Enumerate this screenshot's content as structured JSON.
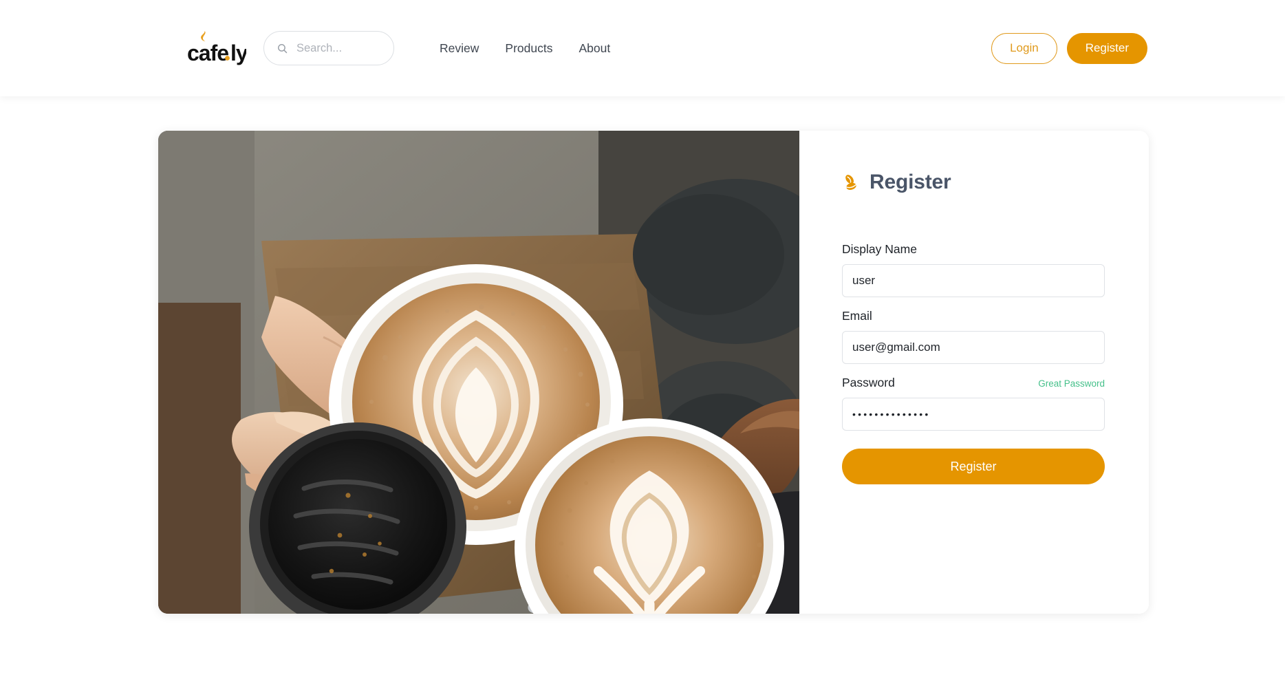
{
  "header": {
    "logo": {
      "name": "cafe.ly",
      "icon": "cafely-steam-logo"
    },
    "search": {
      "icon": "search-icon",
      "placeholder": "Search...",
      "value": ""
    },
    "nav": [
      {
        "label": "Review"
      },
      {
        "label": "Products"
      },
      {
        "label": "About"
      }
    ],
    "auth": {
      "login_label": "Login",
      "register_label": "Register"
    }
  },
  "card": {
    "photo": {
      "alt": "Three hands toasting coffee cups with latte art on a wooden table"
    },
    "form": {
      "icon": "coffee-bean-icon",
      "title": "Register",
      "fields": {
        "display_name": {
          "label": "Display Name",
          "value": "user",
          "placeholder": "Display Name"
        },
        "email": {
          "label": "Email",
          "value": "user@gmail.com",
          "placeholder": "Email"
        },
        "password": {
          "label": "Password",
          "hint": "Great Password",
          "masked_value": "••••••••••••••",
          "placeholder": "Password"
        }
      },
      "submit_label": "Register"
    }
  },
  "colors": {
    "brand_orange": "#e59500",
    "login_outline": "#e09a1c",
    "hint_green": "#45c08a",
    "title_slate": "#4a5568"
  }
}
